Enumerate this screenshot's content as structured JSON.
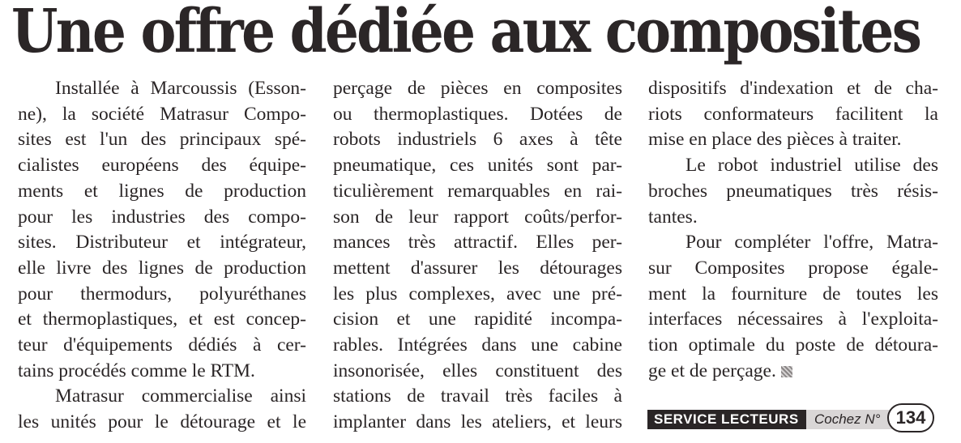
{
  "article": {
    "title": "Une offre dédiée aux composites",
    "columns": [
      [
        {
          "indent": true,
          "text": "Installée à Marcoussis (Esson-"
        },
        {
          "text": "ne), la société Matrasur Compo-"
        },
        {
          "text": "sites est l'un des principaux spé-"
        },
        {
          "text": "cialistes européens des équipe-"
        },
        {
          "text": "ments et lignes de production"
        },
        {
          "text": "pour les industries des compo-"
        },
        {
          "text": "sites. Distributeur et intégrateur,"
        },
        {
          "text": "elle livre des lignes de production"
        },
        {
          "text": "pour thermodurs, polyuréthanes"
        },
        {
          "text": "et thermoplastiques, et est concep-"
        },
        {
          "text": "teur d'équipements dédiés à cer-"
        },
        {
          "text": "tains procédés comme le RTM.",
          "end": true
        },
        {
          "indent": true,
          "text": "Matrasur commercialise ainsi"
        },
        {
          "text": "les unités pour le détourage et le"
        }
      ],
      [
        {
          "text": "perçage de pièces en composites"
        },
        {
          "text": "ou thermoplastiques. Dotées de"
        },
        {
          "text": "robots industriels 6 axes à tête"
        },
        {
          "text": "pneumatique, ces unités sont par-"
        },
        {
          "text": "ticulièrement remarquables en rai-"
        },
        {
          "text": "son de leur rapport coûts/perfor-"
        },
        {
          "text": "mances très attractif. Elles per-"
        },
        {
          "text": "mettent d'assurer les détourages"
        },
        {
          "text": "les plus complexes, avec une pré-"
        },
        {
          "text": "cision et une rapidité incompa-"
        },
        {
          "text": "rables. Intégrées dans une cabine"
        },
        {
          "text": "insonorisée, elles constituent des"
        },
        {
          "text": "stations de travail très faciles à"
        },
        {
          "text": "implanter dans les ateliers, et leurs"
        }
      ],
      [
        {
          "text": "dispositifs d'indexation et de cha-"
        },
        {
          "text": "riots conformateurs facilitent la"
        },
        {
          "text": "mise en place des pièces à traiter.",
          "end": true
        },
        {
          "indent": true,
          "text": "Le robot industriel utilise des"
        },
        {
          "text": "broches pneumatiques très résis-"
        },
        {
          "text": "tantes.",
          "end": true
        },
        {
          "indent": true,
          "text": "Pour compléter l'offre, Matra-"
        },
        {
          "text": "sur Composites propose égale-"
        },
        {
          "text": "ment la fourniture de toutes les"
        },
        {
          "text": "interfaces nécessaires à l'exploita-"
        },
        {
          "text": "tion optimale du poste de détoura-"
        },
        {
          "text": "ge et de perçage.",
          "end": true,
          "endmark": true
        }
      ]
    ]
  },
  "service": {
    "label": "SERVICE LECTEURS",
    "cochez": "Cochez N°",
    "number": "134"
  }
}
